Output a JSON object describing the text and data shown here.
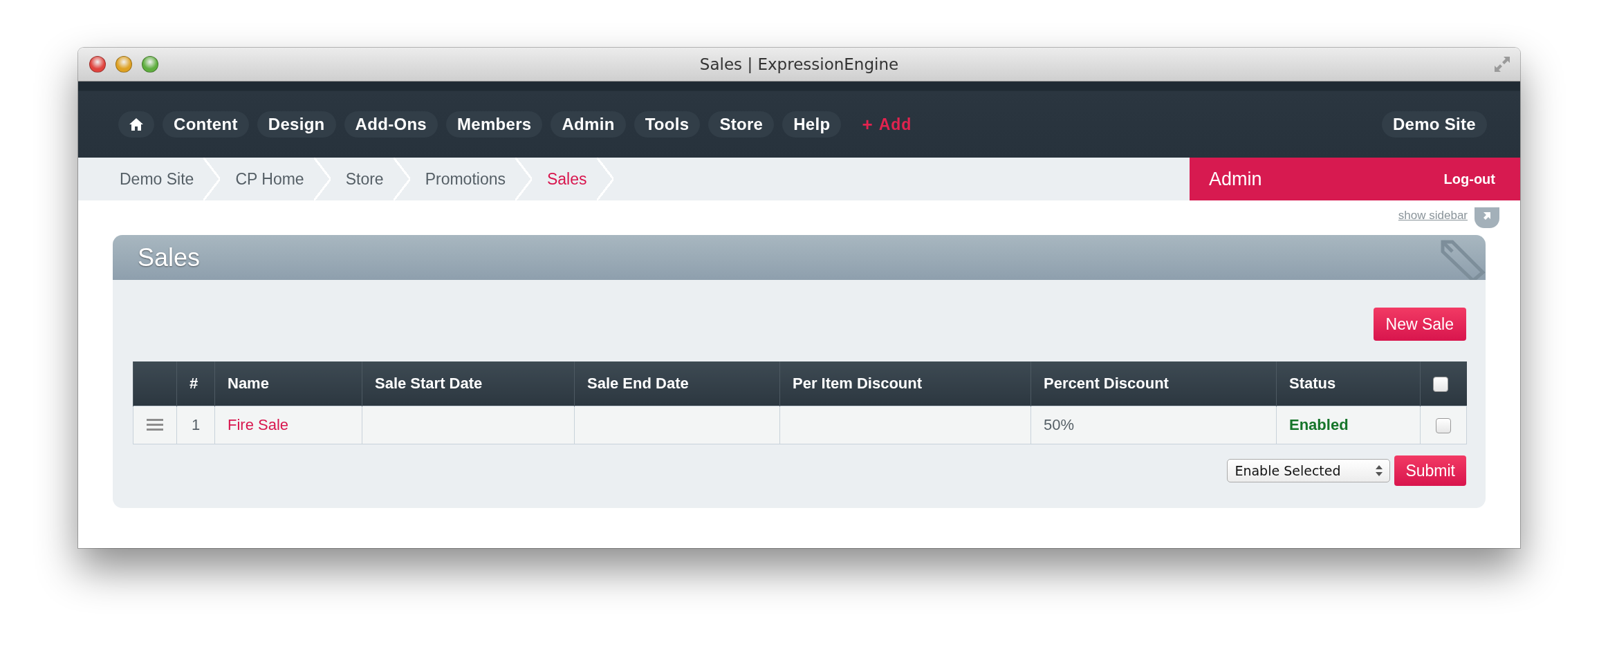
{
  "window": {
    "title": "Sales | ExpressionEngine"
  },
  "nav": {
    "items": [
      {
        "kind": "home"
      },
      {
        "kind": "text",
        "label": "Content"
      },
      {
        "kind": "text",
        "label": "Design"
      },
      {
        "kind": "text",
        "label": "Add-Ons"
      },
      {
        "kind": "text",
        "label": "Members"
      },
      {
        "kind": "text",
        "label": "Admin"
      },
      {
        "kind": "text",
        "label": "Tools"
      },
      {
        "kind": "text",
        "label": "Store"
      },
      {
        "kind": "text",
        "label": "Help"
      }
    ],
    "add": {
      "icon": "+",
      "label": "Add"
    },
    "site": "Demo Site"
  },
  "breadcrumbs": [
    {
      "label": "Demo Site",
      "selected": false
    },
    {
      "label": "CP Home",
      "selected": false
    },
    {
      "label": "Store",
      "selected": false
    },
    {
      "label": "Promotions",
      "selected": false
    },
    {
      "label": "Sales",
      "selected": true
    }
  ],
  "user": {
    "name": "Admin",
    "logout": "Log-out"
  },
  "show_sidebar": "show sidebar",
  "panel": {
    "title": "Sales",
    "new_button": "New Sale",
    "table": {
      "columns": [
        "#",
        "Name",
        "Sale Start Date",
        "Sale End Date",
        "Per Item Discount",
        "Percent Discount",
        "Status"
      ],
      "select_all": {
        "checked": false
      },
      "rows": [
        {
          "number": "1",
          "name": "Fire Sale",
          "start": "",
          "end": "",
          "per_item": "",
          "percent": "50%",
          "status": "Enabled",
          "color": "#16752a",
          "checked": false
        }
      ]
    },
    "action": {
      "value": "Enable Selected"
    },
    "submit": "Submit"
  }
}
